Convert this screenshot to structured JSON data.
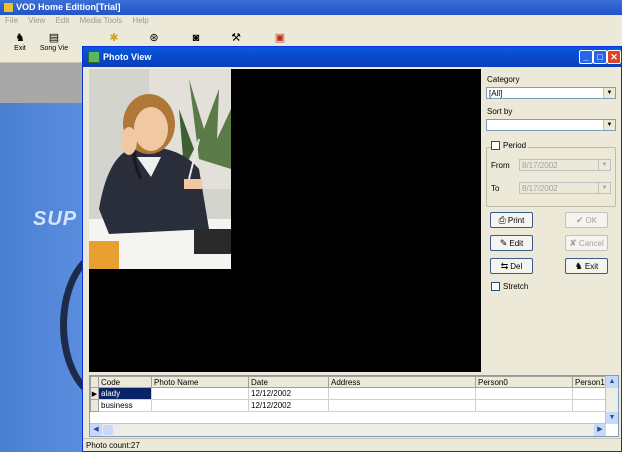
{
  "app": {
    "title": "VOD Home Edition[Trial]",
    "menu": [
      "File",
      "View",
      "Edit",
      "Media Tools",
      "Help"
    ],
    "toolbar": [
      {
        "label": "Exit",
        "icon": "exit-icon",
        "glyph": "♞"
      },
      {
        "label": "Song Vie",
        "icon": "song-view-icon",
        "glyph": "▤"
      },
      {
        "label": "",
        "icon": "photo-icon",
        "glyph": "✱"
      },
      {
        "label": "",
        "icon": "disc-icon",
        "glyph": "⊛"
      },
      {
        "label": "",
        "icon": "camera-icon",
        "glyph": "◙"
      },
      {
        "label": "",
        "icon": "tools-icon",
        "glyph": "⚒"
      },
      {
        "label": "",
        "icon": "tv-icon",
        "glyph": "▣"
      }
    ],
    "background_logo": "SUP"
  },
  "dialog": {
    "title": "Photo View",
    "category_label": "Category",
    "category_value": "[All]",
    "sortby_label": "Sort by",
    "sortby_value": "",
    "period_label": "Period",
    "from_label": "From",
    "from_value": "8/17/2002",
    "to_label": "To",
    "to_value": "8/17/2002",
    "buttons": {
      "print": "Print",
      "ok": "OK",
      "edit": "Edit",
      "cancel": "Cancel",
      "del": "Del",
      "exit": "Exit"
    },
    "stretch_label": "Stretch",
    "grid": {
      "columns": [
        "Code",
        "Photo Name",
        "Date",
        "Address",
        "Person0",
        "Person1"
      ],
      "rows": [
        {
          "code": "alady",
          "photo_name": "",
          "date": "12/12/2002",
          "address": "",
          "person0": "",
          "person1": ""
        },
        {
          "code": "business",
          "photo_name": "",
          "date": "12/12/2002",
          "address": "",
          "person0": "",
          "person1": ""
        }
      ]
    },
    "status": "Photo count:27"
  }
}
